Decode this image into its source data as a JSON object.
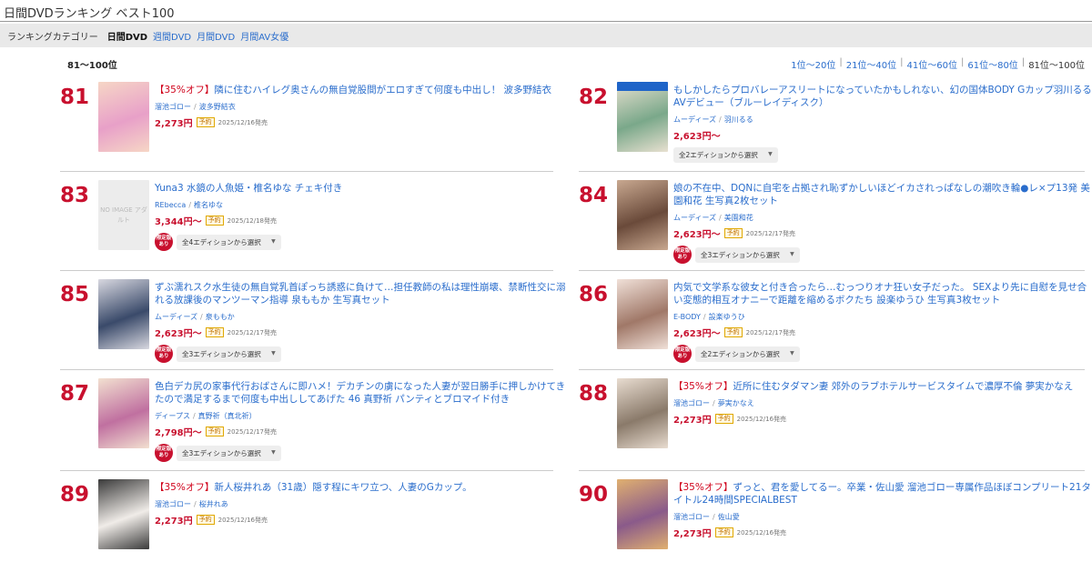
{
  "header": {
    "title": "日間DVDランキング ベスト100"
  },
  "subnav": {
    "label": "ランキングカテゴリー",
    "current": "日間DVD",
    "links": [
      "週間DVD",
      "月間DVD",
      "月間AV女優"
    ]
  },
  "rank_range": "81～100位",
  "pager": {
    "links": [
      "1位～20位",
      "21位～40位",
      "41位～60位",
      "61位～80位"
    ],
    "current": "81位～100位"
  },
  "items": [
    {
      "rank": "81",
      "off": "【35%オフ】",
      "title": "隣に住むハイレグ奥さんの無自覚股間がエロすぎて何度も中出し！ 波多野結衣",
      "maker": "溜池ゴロー",
      "actress": "波多野結衣",
      "price": "2,273円",
      "badge": "予約",
      "date": "2025/12/16発売",
      "editions": "",
      "limited": "",
      "thumb_color": "#e8a0c8",
      "thumb_color2": "#f6d6c6"
    },
    {
      "rank": "82",
      "off": "",
      "title": "もしかしたらプロバレーアスリートになっていたかもしれない、幻の国体BODY Gカップ羽川るるAVデビュー（ブルーレイディスク）",
      "maker": "ムーディーズ",
      "actress": "羽川るる",
      "price": "2,623円～",
      "badge": "",
      "date": "",
      "editions": "全2エディションから選択",
      "limited": "",
      "thumb_color": "#7aa88a",
      "thumb_color2": "#e8e0d0"
    },
    {
      "rank": "83",
      "off": "",
      "title": "Yuna3 水鏡の人魚姫・椎名ゆな チェキ付き",
      "maker": "REbecca",
      "actress": "椎名ゆな",
      "price": "3,344円～",
      "badge": "予約",
      "date": "2025/12/18発売",
      "editions": "全4エディションから選択",
      "limited": "限定版あり",
      "thumb_color": "#ececec",
      "thumb_color2": "#ececec",
      "noimage": "NO IMAGE アダルト"
    },
    {
      "rank": "84",
      "off": "",
      "title": "娘の不在中、DQNに自宅を占拠され恥ずかしいほどイカされっぱなしの潮吹き輪●レ×プ13発 美園和花 生写真2枚セット",
      "maker": "ムーディーズ",
      "actress": "美園和花",
      "price": "2,623円～",
      "badge": "予約",
      "date": "2025/12/17発売",
      "editions": "全3エディションから選択",
      "limited": "限定版あり",
      "thumb_color": "#6a4a3a",
      "thumb_color2": "#c8a890"
    },
    {
      "rank": "85",
      "off": "",
      "title": "ずぶ濡れスク水生徒の無自覚乳首ぽっち誘惑に負けて…担任教師の私は理性崩壊、禁断性交に溺れる放課後のマンツーマン指導 泉ももか 生写真セット",
      "maker": "ムーディーズ",
      "actress": "泉ももか",
      "price": "2,623円～",
      "badge": "予約",
      "date": "2025/12/17発売",
      "editions": "全3エディションから選択",
      "limited": "限定版あり",
      "thumb_color": "#3a4a6a",
      "thumb_color2": "#d8d8e0"
    },
    {
      "rank": "86",
      "off": "",
      "title": "内気で文学系な彼女と付き合ったら…むっつりオナ狂い女子だった。 SEXより先に自慰を見せ合い変態的相互オナニーで距離を縮めるボクたち 設楽ゆうひ 生写真3枚セット",
      "maker": "E-BODY",
      "actress": "設楽ゆうひ",
      "price": "2,623円～",
      "badge": "予約",
      "date": "2025/12/17発売",
      "editions": "全2エディションから選択",
      "limited": "限定版あり",
      "thumb_color": "#a07868",
      "thumb_color2": "#f0e0d8"
    },
    {
      "rank": "87",
      "off": "",
      "title": "色白デカ尻の家事代行おばさんに即ハメ！デカチンの虜になった人妻が翌日勝手に押しかけてきたので満足するまで何度も中出ししてあげた 46 真野祈 パンティとブロマイド付き",
      "maker": "ディープス",
      "actress": "真野祈（真北祈）",
      "price": "2,798円～",
      "badge": "予約",
      "date": "2025/12/17発売",
      "editions": "全3エディションから選択",
      "limited": "限定版あり",
      "thumb_color": "#c070a0",
      "thumb_color2": "#f2e0d0"
    },
    {
      "rank": "88",
      "off": "【35%オフ】",
      "title": "近所に住むタダマン妻 郊外のラブホテルサービスタイムで濃厚不倫 夢実かなえ",
      "maker": "溜池ゴロー",
      "actress": "夢実かなえ",
      "price": "2,273円",
      "badge": "予約",
      "date": "2025/12/16発売",
      "editions": "",
      "limited": "",
      "thumb_color": "#8a7a6a",
      "thumb_color2": "#e8dcd0"
    },
    {
      "rank": "89",
      "off": "【35%オフ】",
      "title": "新人桜井れあ（31歳）隠す程にキワ立つ、人妻のGカップ。",
      "maker": "溜池ゴロー",
      "actress": "桜井れあ",
      "price": "2,273円",
      "badge": "予約",
      "date": "2025/12/16発売",
      "editions": "",
      "limited": "",
      "thumb_color": "#f0ece8",
      "thumb_color2": "#3a3a3a"
    },
    {
      "rank": "90",
      "off": "【35%オフ】",
      "title": "ずっと、君を愛してるー。卒業・佐山愛 溜池ゴロー専属作品ほぼコンプリート21タイトル24時間SPECIALBEST",
      "maker": "溜池ゴロー",
      "actress": "佐山愛",
      "price": "2,273円",
      "badge": "予約",
      "date": "2025/12/16発売",
      "editions": "",
      "limited": "",
      "thumb_color": "#8a5a8a",
      "thumb_color2": "#e0b070"
    }
  ],
  "colors": {
    "rank": "#c8102e",
    "link": "#2a6dcc",
    "price": "#c8102e"
  }
}
